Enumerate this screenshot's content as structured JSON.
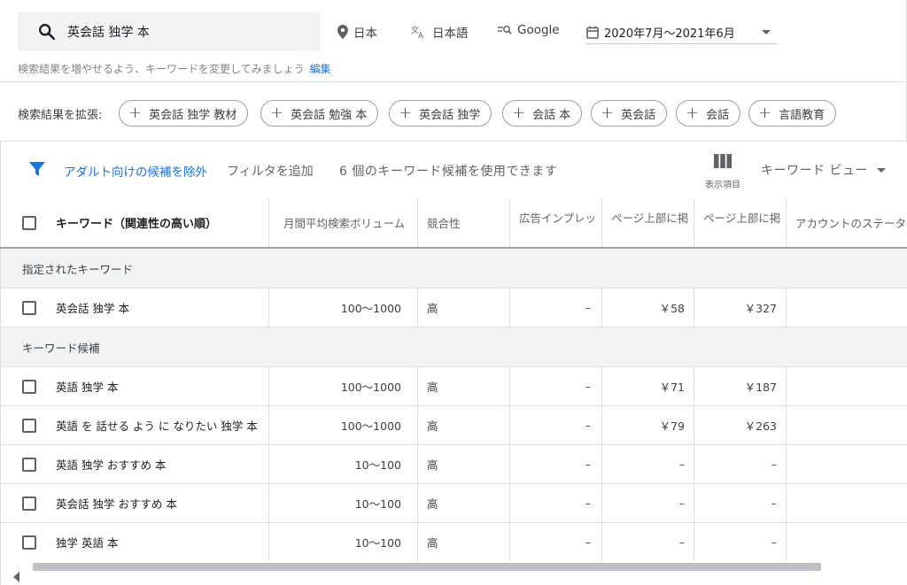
{
  "search": {
    "query": "英会話 独学 本",
    "location": "日本",
    "language": "日本語",
    "network": "Google",
    "date_range": "2020年7月〜2021年6月",
    "hint": "検索結果を増やせるよう、キーワードを変更してみましょう",
    "edit_label": "編集"
  },
  "expand": {
    "label": "検索結果を拡張:",
    "pills": [
      "英会話 独学 教材",
      "英会話 勉強 本",
      "英会話 独学",
      "会話 本",
      "英会話",
      "会話",
      "言語教育"
    ]
  },
  "toolbar": {
    "exclude_adult": "アダルト向けの候補を除外",
    "add_filter": "フィルタを追加",
    "count_text": "6 個のキーワード候補を使用できます",
    "columns_label": "表示項目",
    "view_label": "キーワード ビュー"
  },
  "table": {
    "headers": [
      "キーワード（関連性の高い順）",
      "月間平均検索ボリューム",
      "競合性",
      "広告インプレッ",
      "ページ上部に掲",
      "ページ上部に掲",
      "アカウントのステータ"
    ],
    "section_specified": "指定されたキーワード",
    "specified_rows": [
      [
        "英会話 独学 本",
        "100〜1000",
        "高",
        "–",
        "￥58",
        "￥327",
        ""
      ]
    ],
    "section_ideas": "キーワード候補",
    "idea_rows": [
      [
        "英語 独学 本",
        "100〜1000",
        "高",
        "–",
        "￥71",
        "￥187",
        ""
      ],
      [
        "英語 を 話せる よう に なりたい 独学 本",
        "100〜1000",
        "高",
        "–",
        "￥79",
        "￥263",
        ""
      ],
      [
        "英語 独学 おすすめ 本",
        "10〜100",
        "高",
        "–",
        "–",
        "–",
        ""
      ],
      [
        "英会話 独学 おすすめ 本",
        "10〜100",
        "高",
        "–",
        "–",
        "–",
        ""
      ],
      [
        "独学 英語 本",
        "10〜100",
        "高",
        "–",
        "–",
        "–",
        ""
      ]
    ]
  },
  "colors": {
    "accent": "#1a73e8",
    "search_bg": "#f1f3f4",
    "section_bg": "#f1f3f4",
    "scroll_thumb": "#bdc1c6"
  }
}
